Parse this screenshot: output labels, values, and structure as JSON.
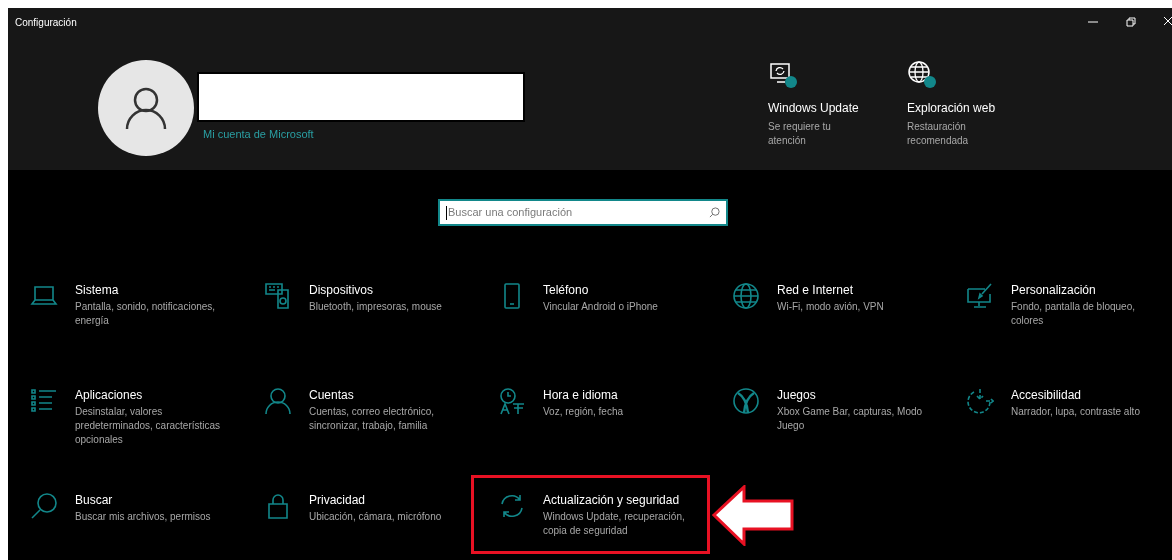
{
  "window": {
    "title": "Configuración",
    "name_redacted": true
  },
  "account": {
    "link": "Mi cuenta de Microsoft"
  },
  "shortcuts": [
    {
      "title": "Windows Update",
      "description": "Se requiere tu atención"
    },
    {
      "title": "Exploración web",
      "description": "Restauración recomendada"
    }
  ],
  "search": {
    "placeholder": "Buscar una configuración"
  },
  "categories": [
    {
      "title": "Sistema",
      "description": "Pantalla, sonido, notificaciones, energía",
      "highlighted": false
    },
    {
      "title": "Dispositivos",
      "description": "Bluetooth, impresoras, mouse",
      "highlighted": false
    },
    {
      "title": "Teléfono",
      "description": "Vincular Android o iPhone",
      "highlighted": false
    },
    {
      "title": "Red e Internet",
      "description": "Wi-Fi, modo avión, VPN",
      "highlighted": false
    },
    {
      "title": "Personalización",
      "description": "Fondo, pantalla de bloqueo, colores",
      "highlighted": false
    },
    {
      "title": "Aplicaciones",
      "description": "Desinstalar, valores predeterminados, características opcionales",
      "highlighted": false
    },
    {
      "title": "Cuentas",
      "description": "Cuentas, correo electrónico, sincronizar, trabajo, familia",
      "highlighted": false
    },
    {
      "title": "Hora e idioma",
      "description": "Voz, región, fecha",
      "highlighted": false
    },
    {
      "title": "Juegos",
      "description": "Xbox Game Bar, capturas, Modo Juego",
      "highlighted": false
    },
    {
      "title": "Accesibilidad",
      "description": "Narrador, lupa, contraste alto",
      "highlighted": false
    },
    {
      "title": "Buscar",
      "description": "Buscar mis archivos, permisos",
      "highlighted": false
    },
    {
      "title": "Privacidad",
      "description": "Ubicación, cámara, micrófono",
      "highlighted": false
    },
    {
      "title": "Actualización y seguridad",
      "description": "Windows Update, recuperación, copia de seguridad",
      "highlighted": true
    }
  ]
}
